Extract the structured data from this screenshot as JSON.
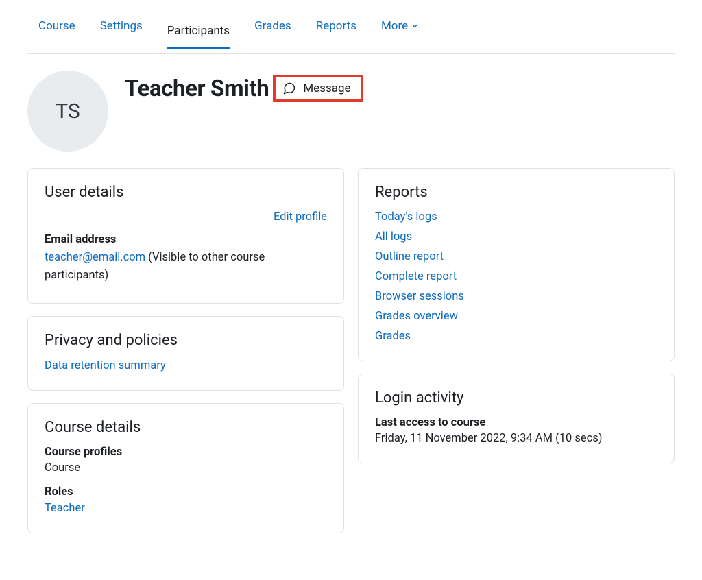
{
  "nav": {
    "tabs": [
      {
        "label": "Course",
        "active": false
      },
      {
        "label": "Settings",
        "active": false
      },
      {
        "label": "Participants",
        "active": true
      },
      {
        "label": "Grades",
        "active": false
      },
      {
        "label": "Reports",
        "active": false
      }
    ],
    "more_label": "More"
  },
  "profile": {
    "initials": "TS",
    "name": "Teacher Smith",
    "message_label": "Message"
  },
  "user_details": {
    "heading": "User details",
    "edit_label": "Edit profile",
    "email_label": "Email address",
    "email_value": "teacher@email.com",
    "email_visibility": " (Visible to other course participants)"
  },
  "privacy": {
    "heading": "Privacy and policies",
    "link": "Data retention summary"
  },
  "course_details": {
    "heading": "Course details",
    "profiles_label": "Course profiles",
    "profiles_value": "Course",
    "roles_label": "Roles",
    "roles_value": "Teacher"
  },
  "reports": {
    "heading": "Reports",
    "items": [
      "Today's logs",
      "All logs",
      "Outline report",
      "Complete report",
      "Browser sessions",
      "Grades overview",
      "Grades"
    ]
  },
  "login_activity": {
    "heading": "Login activity",
    "last_access_label": "Last access to course",
    "last_access_value": "Friday, 11 November 2022, 9:34 AM  (10 secs)"
  },
  "highlight_color": "#e23b2b",
  "link_color": "#0f6cbf"
}
